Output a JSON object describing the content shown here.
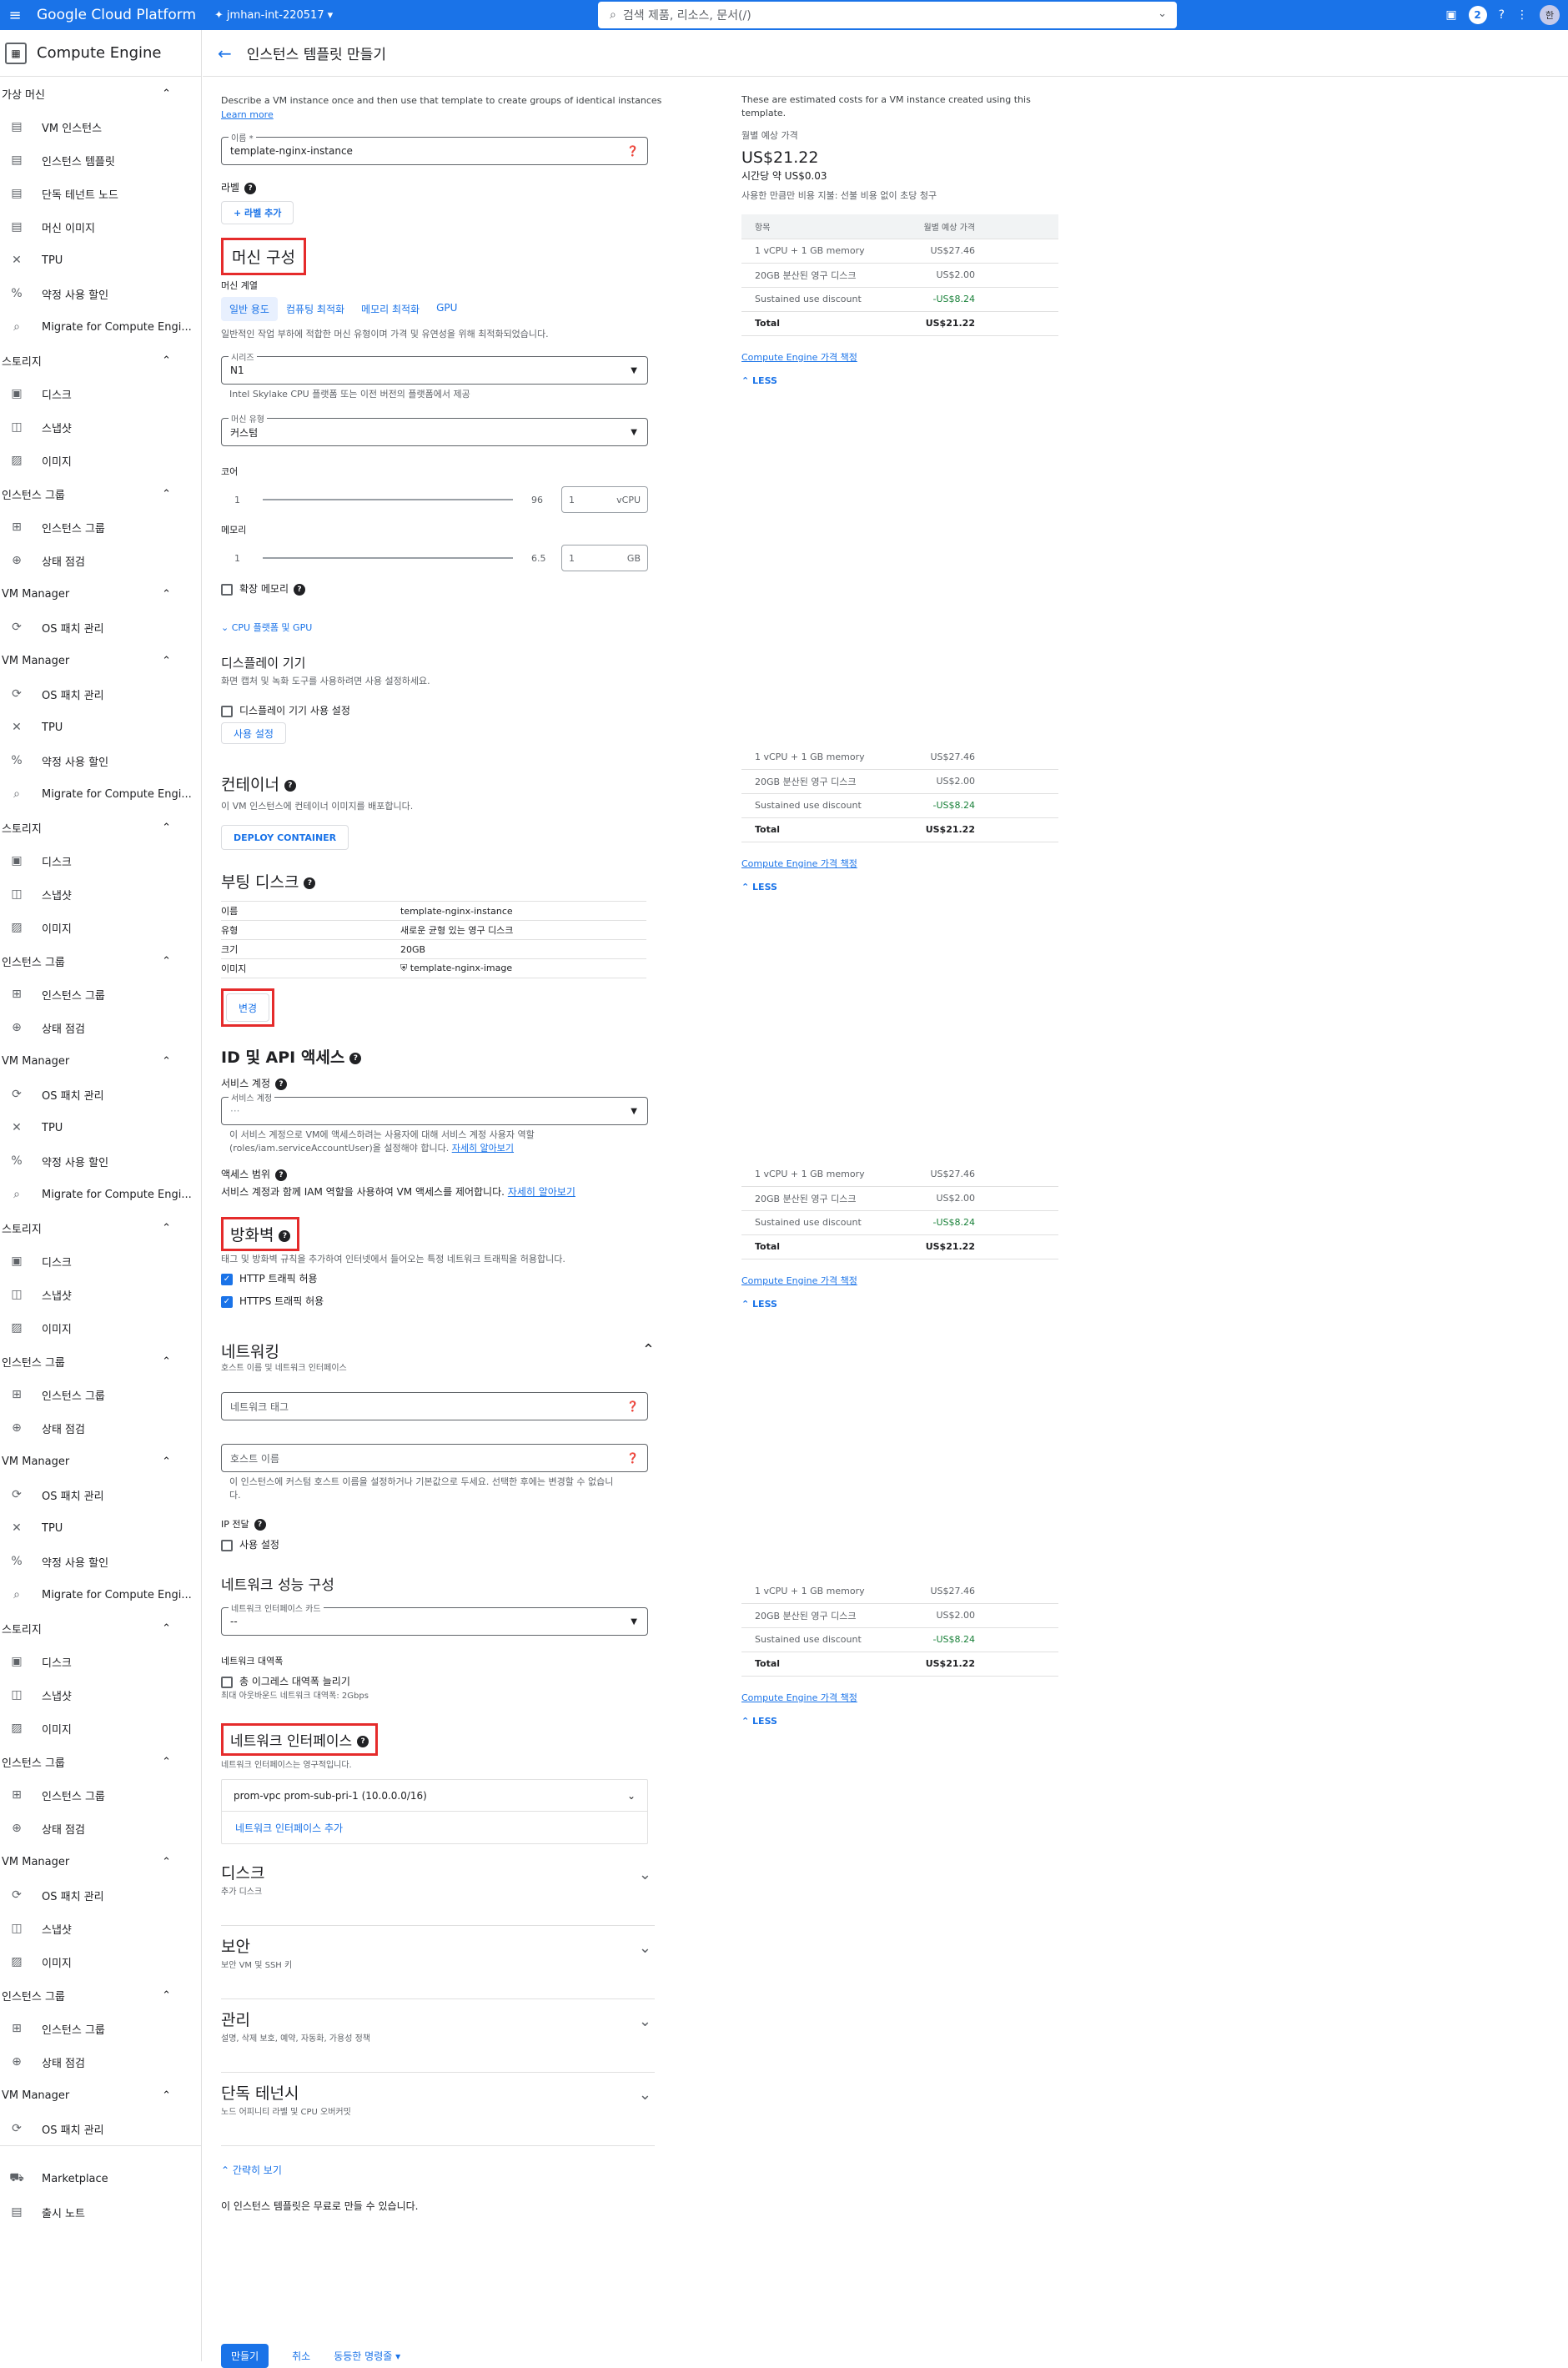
{
  "topbar": {
    "brand": "Google Cloud Platform",
    "project": "jmhan-int-220517",
    "search_placeholder": "검색 제품, 리소스, 문서(/)",
    "notif_count": "2",
    "avatar": "한"
  },
  "sidebar": {
    "title": "Compute Engine",
    "sections": [
      {
        "label": "가상 머신",
        "items": [
          {
            "icon": "vm-icon",
            "glyph": "▤",
            "label": "VM 인스턴스"
          },
          {
            "icon": "template-icon",
            "glyph": "▤",
            "label": "인스턴스 템플릿"
          },
          {
            "icon": "node-icon",
            "glyph": "▤",
            "label": "단독 테넌트 노드"
          },
          {
            "icon": "image-icon",
            "glyph": "▤",
            "label": "머신 이미지"
          },
          {
            "icon": "tpu-icon",
            "glyph": "✕",
            "label": "TPU"
          },
          {
            "icon": "discount-icon",
            "glyph": "%",
            "label": "약정 사용 할인"
          },
          {
            "icon": "search-icon",
            "glyph": "⌕",
            "label": "Migrate for Compute Engi..."
          }
        ]
      },
      {
        "label": "스토리지",
        "items": [
          {
            "icon": "disk-icon",
            "glyph": "▣",
            "label": "디스크"
          },
          {
            "icon": "snapshot-icon",
            "glyph": "◫",
            "label": "스냅샷"
          },
          {
            "icon": "image-icon",
            "glyph": "▨",
            "label": "이미지"
          }
        ]
      },
      {
        "label": "인스턴스 그룹",
        "items": [
          {
            "icon": "group-icon",
            "glyph": "⊞",
            "label": "인스턴스 그룹"
          },
          {
            "icon": "health-icon",
            "glyph": "⊕",
            "label": "상태 점검"
          }
        ]
      },
      {
        "label": "VM Manager",
        "items": [
          {
            "icon": "patch-icon",
            "glyph": "⟳",
            "label": "OS 패치 관리"
          }
        ]
      }
    ],
    "repeat_sections": [
      {
        "label": "VM Manager",
        "items": [
          {
            "icon": "patch-icon",
            "glyph": "⟳",
            "label": "OS 패치 관리"
          }
        ]
      },
      {
        "items": [
          {
            "icon": "tpu-icon",
            "glyph": "✕",
            "label": "TPU"
          },
          {
            "icon": "discount-icon",
            "glyph": "%",
            "label": "약정 사용 할인"
          },
          {
            "icon": "search-icon",
            "glyph": "⌕",
            "label": "Migrate for Compute Engi..."
          }
        ]
      },
      {
        "label": "스토리지",
        "items": [
          {
            "icon": "disk-icon",
            "glyph": "▣",
            "label": "디스크"
          },
          {
            "icon": "snapshot-icon",
            "glyph": "◫",
            "label": "스냅샷"
          },
          {
            "icon": "image-icon",
            "glyph": "▨",
            "label": "이미지"
          }
        ]
      },
      {
        "label": "인스턴스 그룹",
        "items": [
          {
            "icon": "group-icon",
            "glyph": "⊞",
            "label": "인스턴스 그룹"
          },
          {
            "icon": "health-icon",
            "glyph": "⊕",
            "label": "상태 점검"
          }
        ]
      },
      {
        "label": "VM Manager",
        "items": [
          {
            "icon": "patch-icon",
            "glyph": "⟳",
            "label": "OS 패치 관리"
          }
        ]
      },
      {
        "items": [
          {
            "icon": "tpu-icon",
            "glyph": "✕",
            "label": "TPU"
          },
          {
            "icon": "discount-icon",
            "glyph": "%",
            "label": "약정 사용 할인"
          },
          {
            "icon": "search-icon",
            "glyph": "⌕",
            "label": "Migrate for Compute Engi..."
          }
        ]
      },
      {
        "label": "스토리지",
        "items": [
          {
            "icon": "disk-icon",
            "glyph": "▣",
            "label": "디스크"
          },
          {
            "icon": "snapshot-icon",
            "glyph": "◫",
            "label": "스냅샷"
          },
          {
            "icon": "image-icon",
            "glyph": "▨",
            "label": "이미지"
          }
        ]
      },
      {
        "label": "인스턴스 그룹",
        "items": [
          {
            "icon": "group-icon",
            "glyph": "⊞",
            "label": "인스턴스 그룹"
          },
          {
            "icon": "health-icon",
            "glyph": "⊕",
            "label": "상태 점검"
          }
        ]
      },
      {
        "label": "VM Manager",
        "items": [
          {
            "icon": "patch-icon",
            "glyph": "⟳",
            "label": "OS 패치 관리"
          }
        ]
      },
      {
        "items": [
          {
            "icon": "tpu-icon",
            "glyph": "✕",
            "label": "TPU"
          },
          {
            "icon": "discount-icon",
            "glyph": "%",
            "label": "약정 사용 할인"
          },
          {
            "icon": "search-icon",
            "glyph": "⌕",
            "label": "Migrate for Compute Engi..."
          }
        ]
      },
      {
        "label": "스토리지",
        "items": [
          {
            "icon": "disk-icon",
            "glyph": "▣",
            "label": "디스크"
          },
          {
            "icon": "snapshot-icon",
            "glyph": "◫",
            "label": "스냅샷"
          },
          {
            "icon": "image-icon",
            "glyph": "▨",
            "label": "이미지"
          }
        ]
      },
      {
        "label": "인스턴스 그룹",
        "items": [
          {
            "icon": "group-icon",
            "glyph": "⊞",
            "label": "인스턴스 그룹"
          },
          {
            "icon": "health-icon",
            "glyph": "⊕",
            "label": "상태 점검"
          }
        ]
      },
      {
        "label": "VM Manager",
        "items": [
          {
            "icon": "patch-icon",
            "glyph": "⟳",
            "label": "OS 패치 관리"
          }
        ]
      },
      {
        "items": [
          {
            "icon": "snapshot-icon",
            "glyph": "◫",
            "label": "스냅샷"
          },
          {
            "icon": "image-icon",
            "glyph": "▨",
            "label": "이미지"
          }
        ]
      },
      {
        "label": "인스턴스 그룹",
        "items": [
          {
            "icon": "group-icon",
            "glyph": "⊞",
            "label": "인스턴스 그룹"
          },
          {
            "icon": "health-icon",
            "glyph": "⊕",
            "label": "상태 점검"
          }
        ]
      },
      {
        "label": "VM Manager",
        "items": [
          {
            "icon": "patch-icon",
            "glyph": "⟳",
            "label": "OS 패치 관리"
          }
        ]
      }
    ],
    "bottom_items": [
      {
        "icon": "marketplace-icon",
        "glyph": "⛟",
        "label": "Marketplace"
      },
      {
        "icon": "notes-icon",
        "glyph": "▤",
        "label": "출시 노트"
      }
    ]
  },
  "page": {
    "title": "인스턴스 템플릿 만들기",
    "intro": "Describe a VM instance once and then use that template to create groups of identical instances",
    "learn_more": "Learn more",
    "name_label": "이름 *",
    "name_value": "template-nginx-instance",
    "labels_title": "라벨",
    "add_label": "+ 라벨 추가",
    "machine_config": "머신 구성",
    "machine_family": "머신 계열",
    "tabs": [
      "일반 용도",
      "컴퓨팅 최적화",
      "메모리 최적화",
      "GPU"
    ],
    "family_desc": "일반적인 작업 부하에 적합한 머신 유형이며 가격 및 유연성을 위해 최적화되었습니다.",
    "series_label": "시리즈",
    "series_value": "N1",
    "series_hint": "Intel Skylake CPU 플랫폼 또는 이전 버전의 플랫폼에서 제공",
    "machine_type_label": "머신 유형",
    "machine_type_value": "커스텀",
    "cores_label": "코어",
    "cores_min": "1",
    "cores_max": "96",
    "cores_value": "1",
    "cores_unit": "vCPU",
    "memory_label": "메모리",
    "mem_min": "1",
    "mem_max": "6.5",
    "mem_value": "1",
    "mem_unit": "GB",
    "extend_memory": "확장 메모리",
    "cpu_platform": "CPU 플랫폼 및 GPU",
    "display_title": "디스플레이 기기",
    "display_desc": "화면 캡처 및 녹화 도구를 사용하려면 사용 설정하세요.",
    "display_cb": "디스플레이 기기 사용 설정",
    "display_btn": "사용 설정",
    "container_title": "컨테이너",
    "container_desc": "이 VM 인스턴스에 컨테이너 이미지를 배포합니다.",
    "deploy_btn": "DEPLOY CONTAINER",
    "boot_title": "부팅 디스크",
    "boot_rows": [
      [
        "이름",
        "template-nginx-instance"
      ],
      [
        "유형",
        "새로운 균형 있는 영구 디스크"
      ],
      [
        "크기",
        "20GB"
      ],
      [
        "이미지",
        "template-nginx-image"
      ]
    ],
    "change_btn": "변경",
    "id_title": "ID 및 API 액세스",
    "svc_label": "서비스 계정",
    "svc_field_label": "서비스 계정",
    "svc_value": "···",
    "svc_hint": "이 서비스 계정으로 VM에 액세스하려는 사용자에 대해 서비스 계정 사용자 역할 (roles/iam.serviceAccountUser)을 설정해야 합니다.",
    "svc_link": "자세히 알아보기",
    "scope_label": "액세스 범위",
    "scope_desc": "서비스 계정과 함께 IAM 역할을 사용하여 VM 액세스를 제어합니다.",
    "scope_link": "자세히 알아보기",
    "firewall_title": "방화벽",
    "firewall_desc": "태그 및 방화벽 규칙을 추가하여 인터넷에서 들어오는 특정 네트워크 트래픽을 허용합니다.",
    "http": "HTTP 트래픽 허용",
    "https": "HTTPS 트래픽 허용",
    "net_title": "네트워킹",
    "net_sub": "호스트 이름 및 네트워크 인터페이스",
    "net_tags_ph": "네트워크 태그",
    "hostname_ph": "호스트 이름",
    "hostname_hint": "이 인스턴스에 커스텀 호스트 이름을 설정하거나 기본값으로 두세요. 선택한 후에는 변경할 수 없습니다.",
    "ip_fwd": "IP 전달",
    "ip_fwd_cb": "사용 설정",
    "perf_title": "네트워크 성능 구성",
    "nic_card_label": "네트워크 인터페이스 카드",
    "nic_card_value": "--",
    "bw_title": "네트워크 대역폭",
    "bw_cb": "총 이그레스 대역폭 늘리기",
    "bw_hint": "최대 아웃바운드 네트워크 대역폭: 2Gbps",
    "nic_title": "네트워크 인터페이스",
    "nic_desc": "네트워크 인터페이스는 영구적입니다.",
    "nic_value": "prom-vpc prom-sub-pri-1 (10.0.0.0/16)",
    "nic_add": "네트워크 인터페이스 추가",
    "sections": [
      {
        "t": "디스크",
        "s": "추가 디스크"
      },
      {
        "t": "보안",
        "s": "보안 VM 및 SSH 키"
      },
      {
        "t": "관리",
        "s": "설명, 삭제 보호, 예약, 자동화, 가용성 정책"
      },
      {
        "t": "단독 테넌시",
        "s": "노드 어피니티 라벨 및 CPU 오버커밋"
      }
    ],
    "simple": "간략히 보기",
    "free_note": "이 인스턴스 템플릿은 무료로 만들 수 있습니다.",
    "create": "만들기",
    "cancel": "취소",
    "equiv": "동등한 명령줄"
  },
  "cost": {
    "desc": "These are estimated costs for a VM instance created using this template.",
    "monthly_label": "월별 예상 가격",
    "monthly": "US$21.22",
    "hourly": "시간당 약 US$0.03",
    "pay_note": "사용한 만큼만 비용 지불: 선불 비용 없이 초당 청구",
    "head": [
      "항목",
      "월별 예상 가격"
    ],
    "rows": [
      [
        "1 vCPU + 1 GB memory",
        "US$27.46"
      ],
      [
        "20GB 분산된 영구 디스크",
        "US$2.00"
      ],
      [
        "Sustained use discount",
        "-US$8.24"
      ],
      [
        "Total",
        "US$21.22"
      ]
    ],
    "link": "Compute Engine 가격 책정",
    "less": "LESS"
  }
}
